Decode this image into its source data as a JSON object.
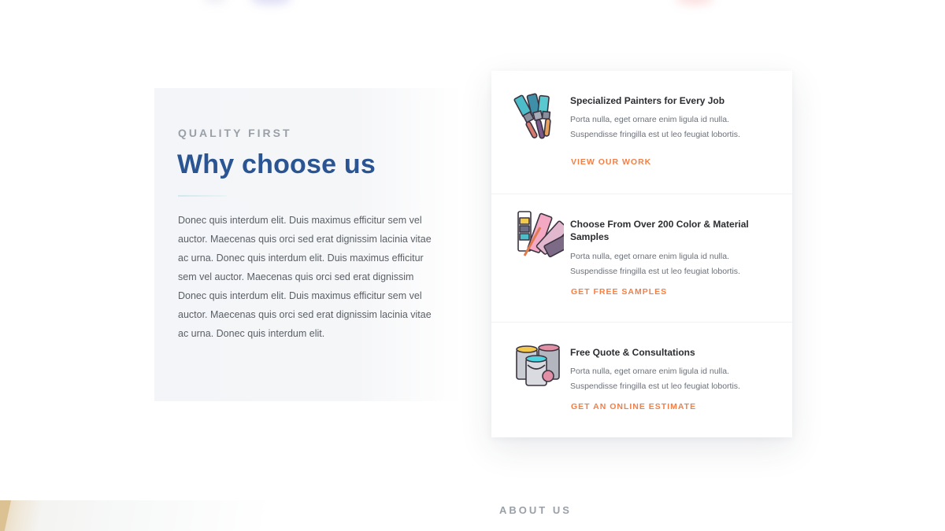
{
  "why": {
    "eyebrow": "QUALITY FIRST",
    "title": "Why choose us",
    "body": "Donec quis interdum elit. Duis maximus efficitur sem vel auctor. Maecenas quis orci sed erat dignissim lacinia vitae ac urna. Donec quis interdum elit. Duis maximus efficitur sem vel auctor. Maecenas quis orci sed erat dignissim Donec quis interdum elit. Duis maximus efficitur sem vel auctor. Maecenas quis orci sed erat dignissim lacinia vitae ac urna. Donec quis interdum elit."
  },
  "features": [
    {
      "icon": "paint-brushes-icon",
      "title": "Specialized Painters for Every Job",
      "desc": "Porta nulla, eget ornare enim ligula id nulla. Suspendisse fringilla est ut leo feugiat lobortis.",
      "link": "VIEW OUR WORK"
    },
    {
      "icon": "color-swatches-icon",
      "title": "Choose From Over 200 Color & Material Samples",
      "desc": "Porta nulla, eget ornare enim ligula id nulla. Suspendisse fringilla est ut leo feugiat lobortis.",
      "link": "GET FREE SAMPLES"
    },
    {
      "icon": "paint-cans-icon",
      "title": "Free Quote & Consultations",
      "desc": "Porta nulla, eget ornare enim ligula id nulla. Suspendisse fringilla est ut leo feugiat lobortis.",
      "link": "GET AN ONLINE ESTIMATE"
    }
  ],
  "about": {
    "label": "ABOUT US"
  },
  "colors": {
    "heading": "#2a5592",
    "accent_link": "#f47f45",
    "eyebrow": "#9aa0a8",
    "panel_bg": "#f4f6f8"
  }
}
